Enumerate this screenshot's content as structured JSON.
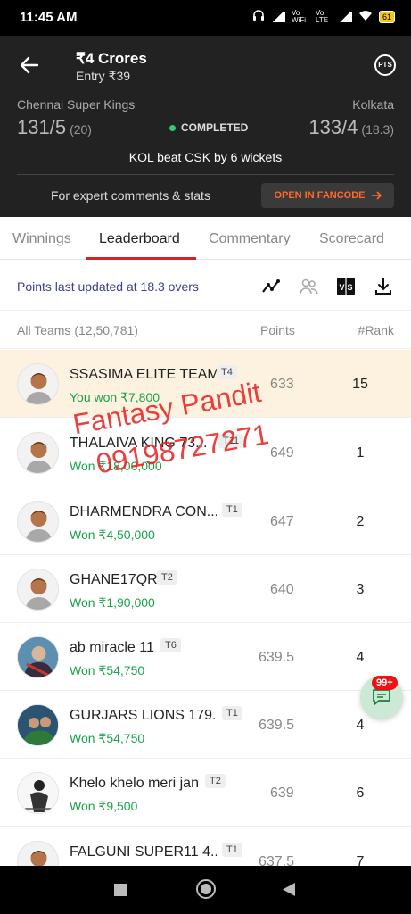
{
  "status_bar": {
    "time": "11:45 AM",
    "indicators": [
      "headphones-icon",
      "signal-icon",
      "vo-wifi",
      "vo-lte",
      "signal-icon",
      "wifi-icon"
    ],
    "vo_wifi_text": "Vo WiFi",
    "vo_lte_text": "Vo LTE",
    "battery": "61"
  },
  "header": {
    "prize": "₹4 Crores",
    "entry": "Entry ₹39",
    "pts_label": "PTS",
    "team_left": {
      "name": "Chennai Super Kings",
      "score": "131/5",
      "overs": "(20)"
    },
    "team_right": {
      "name": "Kolkata",
      "score": "133/4",
      "overs": "(18.3)"
    },
    "status": "COMPLETED",
    "result": "KOL beat CSK by 6 wickets",
    "expert_text": "For expert comments & stats",
    "fancode_label": "OPEN IN FANCODE"
  },
  "tabs": [
    {
      "label": "Winnings",
      "active": false
    },
    {
      "label": "Leaderboard",
      "active": true
    },
    {
      "label": "Commentary",
      "active": false
    },
    {
      "label": "Scorecard",
      "active": false
    }
  ],
  "points_bar": {
    "updated_text": "Points last updated at 18.3 overs"
  },
  "list_header": {
    "teams": "All Teams (12,50,781)",
    "points": "Points",
    "rank": "#Rank"
  },
  "rows": [
    {
      "name": "SSASIMA ELITE TEAM",
      "tag": "T4",
      "won": "You won ₹7,800",
      "points": "633",
      "rank": "15"
    },
    {
      "name": "THALAIVA KING 73...",
      "tag": "T11",
      "won": "Won ₹18,00,000",
      "points": "649",
      "rank": "1"
    },
    {
      "name": "DHARMENDRA CON...",
      "tag": "T1",
      "won": "Won ₹4,50,000",
      "points": "647",
      "rank": "2"
    },
    {
      "name": "GHANE17QR",
      "tag": "T2",
      "won": "Won ₹1,90,000",
      "points": "640",
      "rank": "3"
    },
    {
      "name": "ab miracle 11",
      "tag": "T6",
      "won": "Won ₹54,750",
      "points": "639.5",
      "rank": "4"
    },
    {
      "name": "GURJARS LIONS 179...",
      "tag": "T1",
      "won": "Won ₹54,750",
      "points": "639.5",
      "rank": "4"
    },
    {
      "name": "Khelo khelo meri jan",
      "tag": "T2",
      "won": "Won ₹9,500",
      "points": "639",
      "rank": "6"
    },
    {
      "name": "FALGUNI SUPER11 4...",
      "tag": "T1",
      "won": "",
      "points": "637.5",
      "rank": "7"
    }
  ],
  "watermark": {
    "line1": "Fantasy Pandit",
    "line2": "09198727271"
  },
  "chat": {
    "badge": "99+"
  },
  "colors": {
    "accent_red": "#d0232a",
    "won_green": "#1aa34a",
    "highlight_row": "#fdf1df",
    "header_bg": "#222222",
    "fancode_orange": "#ff6a2b"
  }
}
